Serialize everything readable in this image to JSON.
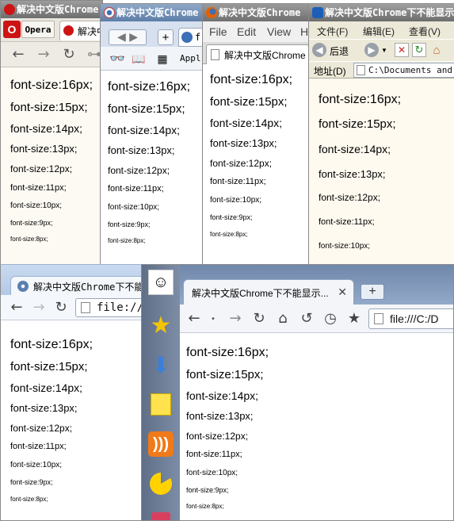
{
  "opera": {
    "title": "解决中文版Chrome",
    "menu_label": "Opera",
    "tab_title": "解决中",
    "lines": [
      "font-size:16px;",
      "font-size:15px;",
      "font-size:14px;",
      "font-size:13px;",
      "font-size:12px;",
      "font-size:11px;",
      "font-size:10px;",
      "font-size:9px;",
      "font-size:8px;"
    ]
  },
  "chrome1": {
    "title": "解决中文版Chrome",
    "tab_partial": "f",
    "apps_label": "Appl",
    "lines": [
      "font-size:16px;",
      "font-size:15px;",
      "font-size:14px;",
      "font-size:13px;",
      "font-size:12px;",
      "font-size:11px;",
      "font-size:10px;",
      "font-size:9px;",
      "font-size:8px;"
    ]
  },
  "firefox": {
    "title": "解决中文版Chrome",
    "menu": [
      "File",
      "Edit",
      "View",
      "H"
    ],
    "tab_title": "解决中文版Chrome",
    "lines": [
      "font-size:16px;",
      "font-size:15px;",
      "font-size:14px;",
      "font-size:13px;",
      "font-size:12px;",
      "font-size:11px;",
      "font-size:10px;",
      "font-size:9px;",
      "font-size:8px;"
    ]
  },
  "ie": {
    "title": "解决中文版Chrome下不能显示",
    "menu": [
      "文件(F)",
      "编辑(E)",
      "查看(V)"
    ],
    "back_label": "后退",
    "address_label": "地址(D)",
    "address_value": "C:\\Documents and S",
    "lines": [
      "font-size:16px;",
      "font-size:15px;",
      "font-size:14px;",
      "font-size:13px;",
      "font-size:12px;",
      "font-size:11px;",
      "font-size:10px;"
    ]
  },
  "chrome2": {
    "tab_title": "解决中文版Chrome下不能显",
    "address_value": "file:///",
    "lines": [
      "font-size:16px;",
      "font-size:15px;",
      "font-size:14px;",
      "font-size:13px;",
      "font-size:12px;",
      "font-size:11px;",
      "font-size:10px;",
      "font-size:9px;",
      "font-size:8px;"
    ]
  },
  "chrome3": {
    "tab_title": "解决中文版Chrome下不能显示...",
    "address_value": "file:///C:/D",
    "lines": [
      "font-size:16px;",
      "font-size:15px;",
      "font-size:14px;",
      "font-size:13px;",
      "font-size:12px;",
      "font-size:11px;",
      "font-size:10px;",
      "font-size:9px;",
      "font-size:8px;"
    ]
  },
  "colors": {
    "opera_red": "#cc1414",
    "chrome_blue": "#3b6fb6",
    "firefox_orange": "#e66000",
    "ie_blue": "#1c5fb8"
  },
  "icons": [
    "opera-logo-icon",
    "back-icon",
    "forward-icon",
    "reload-icon",
    "home-icon",
    "star-icon",
    "download-icon",
    "notes-icon",
    "rss-icon",
    "pacman-icon",
    "bag-icon",
    "glasses-icon",
    "book-icon",
    "grid-icon",
    "new-tab-icon",
    "globe-icon",
    "close-icon",
    "history-icon",
    "undo-icon",
    "search-icon",
    "favorites-icon",
    "stop-icon",
    "refresh-icon"
  ]
}
